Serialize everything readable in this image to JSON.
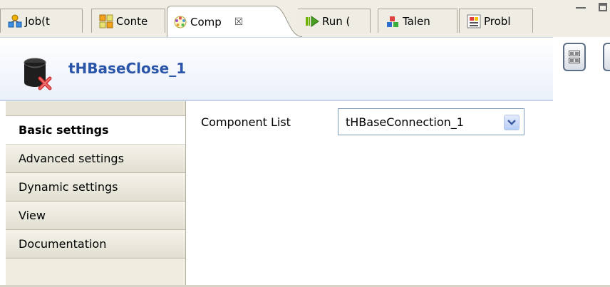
{
  "tabs": [
    {
      "label": "Job(t",
      "icon": "job-icon"
    },
    {
      "label": "Conte",
      "icon": "contexts-icon"
    },
    {
      "label": "Comp",
      "icon": "component-icon",
      "active": true
    },
    {
      "label": "Run (",
      "icon": "run-icon"
    },
    {
      "label": "Talen",
      "icon": "talend-icon"
    },
    {
      "label": "Probl",
      "icon": "problems-icon"
    }
  ],
  "close_glyph": "☒",
  "header": {
    "title": "tHBaseClose_1",
    "icon": "hbase-close-icon"
  },
  "nav": {
    "items": [
      {
        "label": "Basic settings",
        "selected": true
      },
      {
        "label": "Advanced settings"
      },
      {
        "label": "Dynamic settings"
      },
      {
        "label": "View"
      },
      {
        "label": "Documentation"
      }
    ]
  },
  "content": {
    "component_list_label": "Component List",
    "component_list_value": "tHBaseConnection_1"
  },
  "colors": {
    "title": "#2a55a8",
    "accent_border": "#7f9db9",
    "nav_bg": "#efece0"
  }
}
